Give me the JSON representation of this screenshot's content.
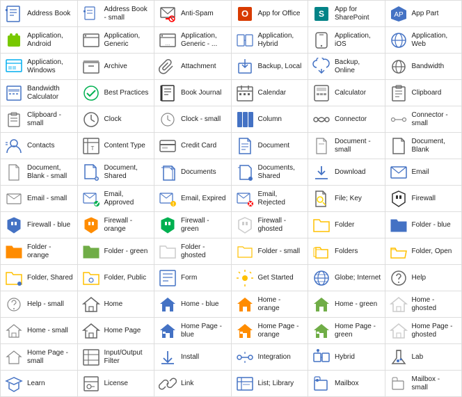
{
  "items": [
    {
      "label": "Address Book",
      "icon": "address-book"
    },
    {
      "label": "Address Book - small",
      "icon": "address-book-small"
    },
    {
      "label": "Anti-Spam",
      "icon": "anti-spam"
    },
    {
      "label": "App for Office",
      "icon": "app-for-office"
    },
    {
      "label": "App for SharePoint",
      "icon": "app-for-sharepoint"
    },
    {
      "label": "App Part",
      "icon": "app-part"
    },
    {
      "label": "Application, Android",
      "icon": "application-android"
    },
    {
      "label": "Application, Generic",
      "icon": "application-generic"
    },
    {
      "label": "Application, Generic - ...",
      "icon": "application-generic-alt"
    },
    {
      "label": "Application, Hybrid",
      "icon": "application-hybrid"
    },
    {
      "label": "Application, iOS",
      "icon": "application-ios"
    },
    {
      "label": "Application, Web",
      "icon": "application-web"
    },
    {
      "label": "Application, Windows",
      "icon": "application-windows"
    },
    {
      "label": "Archive",
      "icon": "archive"
    },
    {
      "label": "Attachment",
      "icon": "attachment"
    },
    {
      "label": "Backup, Local",
      "icon": "backup-local"
    },
    {
      "label": "Backup, Online",
      "icon": "backup-online"
    },
    {
      "label": "Bandwidth",
      "icon": "bandwidth"
    },
    {
      "label": "Bandwidth Calculator",
      "icon": "bandwidth-calculator"
    },
    {
      "label": "Best Practices",
      "icon": "best-practices"
    },
    {
      "label": "Book Journal",
      "icon": "book-journal"
    },
    {
      "label": "Calendar",
      "icon": "calendar"
    },
    {
      "label": "Calculator",
      "icon": "calculator"
    },
    {
      "label": "Clipboard",
      "icon": "clipboard"
    },
    {
      "label": "Clipboard - small",
      "icon": "clipboard-small"
    },
    {
      "label": "Clock",
      "icon": "clock"
    },
    {
      "label": "Clock - small",
      "icon": "clock-small"
    },
    {
      "label": "Column",
      "icon": "column"
    },
    {
      "label": "Connector",
      "icon": "connector"
    },
    {
      "label": "Connector - small",
      "icon": "connector-small"
    },
    {
      "label": "Contacts",
      "icon": "contacts"
    },
    {
      "label": "Content Type",
      "icon": "content-type"
    },
    {
      "label": "Credit Card",
      "icon": "credit-card"
    },
    {
      "label": "Document",
      "icon": "document"
    },
    {
      "label": "Document - small",
      "icon": "document-small"
    },
    {
      "label": "Document, Blank",
      "icon": "document-blank"
    },
    {
      "label": "Document, Blank - small",
      "icon": "document-blank-small"
    },
    {
      "label": "Document, Shared",
      "icon": "document-shared"
    },
    {
      "label": "Documents",
      "icon": "documents"
    },
    {
      "label": "Documents, Shared",
      "icon": "documents-shared"
    },
    {
      "label": "Download",
      "icon": "download"
    },
    {
      "label": "Email",
      "icon": "email"
    },
    {
      "label": "Email - small",
      "icon": "email-small"
    },
    {
      "label": "Email, Approved",
      "icon": "email-approved"
    },
    {
      "label": "Email, Expired",
      "icon": "email-expired"
    },
    {
      "label": "Email, Rejected",
      "icon": "email-rejected"
    },
    {
      "label": "File; Key",
      "icon": "file-key"
    },
    {
      "label": "Firewall",
      "icon": "firewall"
    },
    {
      "label": "Firewall - blue",
      "icon": "firewall-blue"
    },
    {
      "label": "Firewall - orange",
      "icon": "firewall-orange"
    },
    {
      "label": "Firewall - green",
      "icon": "firewall-green"
    },
    {
      "label": "Firewall - ghosted",
      "icon": "firewall-ghosted"
    },
    {
      "label": "Folder",
      "icon": "folder"
    },
    {
      "label": "Folder - blue",
      "icon": "folder-blue"
    },
    {
      "label": "Folder - orange",
      "icon": "folder-orange"
    },
    {
      "label": "Folder - green",
      "icon": "folder-green"
    },
    {
      "label": "Folder - ghosted",
      "icon": "folder-ghosted"
    },
    {
      "label": "Folder - small",
      "icon": "folder-small"
    },
    {
      "label": "Folders",
      "icon": "folders"
    },
    {
      "label": "Folder, Open",
      "icon": "folder-open"
    },
    {
      "label": "Folder, Shared",
      "icon": "folder-shared"
    },
    {
      "label": "Folder, Public",
      "icon": "folder-public"
    },
    {
      "label": "Form",
      "icon": "form"
    },
    {
      "label": "Get Started",
      "icon": "get-started"
    },
    {
      "label": "Globe; Internet",
      "icon": "globe"
    },
    {
      "label": "Help",
      "icon": "help"
    },
    {
      "label": "Help - small",
      "icon": "help-small"
    },
    {
      "label": "Home",
      "icon": "home"
    },
    {
      "label": "Home - blue",
      "icon": "home-blue"
    },
    {
      "label": "Home - orange",
      "icon": "home-orange"
    },
    {
      "label": "Home - green",
      "icon": "home-green"
    },
    {
      "label": "Home - ghosted",
      "icon": "home-ghosted"
    },
    {
      "label": "Home - small",
      "icon": "home-small"
    },
    {
      "label": "Home Page",
      "icon": "home-page"
    },
    {
      "label": "Home Page - blue",
      "icon": "home-page-blue"
    },
    {
      "label": "Home Page - orange",
      "icon": "home-page-orange"
    },
    {
      "label": "Home Page - green",
      "icon": "home-page-green"
    },
    {
      "label": "Home Page - ghosted",
      "icon": "home-page-ghosted"
    },
    {
      "label": "Home Page - small",
      "icon": "home-page-small"
    },
    {
      "label": "Input/Output Filter",
      "icon": "input-output-filter"
    },
    {
      "label": "Install",
      "icon": "install"
    },
    {
      "label": "Integration",
      "icon": "integration"
    },
    {
      "label": "Hybrid",
      "icon": "hybrid"
    },
    {
      "label": "Lab",
      "icon": "lab"
    },
    {
      "label": "Learn",
      "icon": "learn"
    },
    {
      "label": "License",
      "icon": "license"
    },
    {
      "label": "Link",
      "icon": "link"
    },
    {
      "label": "List; Library",
      "icon": "list-library"
    },
    {
      "label": "Mailbox",
      "icon": "mailbox"
    },
    {
      "label": "Mailbox - small",
      "icon": "mailbox-small"
    }
  ]
}
